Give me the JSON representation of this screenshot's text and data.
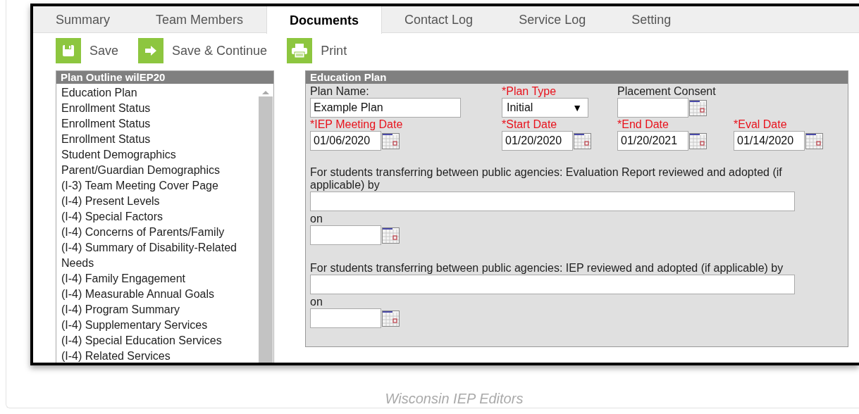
{
  "tabs": [
    {
      "label": "Summary",
      "selected": false
    },
    {
      "label": "Team Members",
      "selected": false
    },
    {
      "label": "Documents",
      "selected": true
    },
    {
      "label": "Contact Log",
      "selected": false
    },
    {
      "label": "Service Log",
      "selected": false
    },
    {
      "label": "Setting",
      "selected": false
    }
  ],
  "toolbar": [
    {
      "label": "Save",
      "kind": "save"
    },
    {
      "label": "Save & Continue",
      "kind": "continue"
    },
    {
      "label": "Print",
      "kind": "print"
    }
  ],
  "outline": {
    "title": "Plan Outline wilEP20",
    "items": [
      "Education Plan",
      "Enrollment Status",
      "Enrollment Status",
      "Enrollment Status",
      "Student Demographics",
      "Parent/Guardian Demographics",
      "(I-3) Team Meeting Cover Page",
      "(I-4) Present Levels",
      "(I-4) Special Factors",
      "(I-4) Concerns of Parents/Family",
      "(I-4) Summary of Disability-Related Needs",
      "(I-4) Family Engagement",
      "(I-4) Measurable Annual Goals",
      "(I-4) Program Summary",
      "(I-4) Supplementary Services",
      "(I-4) Special Education Services",
      "(I-4) Related Services"
    ]
  },
  "form": {
    "title": "Education Plan",
    "rows": [
      {
        "fields": [
          {
            "label": "Plan Name:",
            "required": false,
            "kind": "text",
            "value": "Example Plan"
          },
          {
            "label": "*Plan Type",
            "required": true,
            "kind": "select",
            "value": "Initial",
            "arrow": "▼"
          },
          {
            "label": "Placement Consent",
            "required": false,
            "kind": "date"
          }
        ]
      },
      {
        "fields": [
          {
            "label": "*IEP Meeting Date",
            "required": true,
            "kind": "date",
            "value": "01/06/2020"
          },
          {
            "label": "*Start Date",
            "required": true,
            "kind": "date",
            "value": "01/20/2020"
          },
          {
            "label": "*End Date",
            "required": true,
            "kind": "date",
            "value": "01/20/2021"
          },
          {
            "label": "*Eval Date",
            "required": true,
            "kind": "date",
            "value": "01/14/2020"
          }
        ]
      }
    ],
    "transfers": [
      {
        "label": "For students transferring between public agencies: Evaluation Report reviewed and adopted (if applicable) by",
        "on_label": "on"
      },
      {
        "label": "For students transferring between public agencies: IEP reviewed and adopted (if applicable) by",
        "on_label": "on"
      }
    ]
  },
  "caption": "Wisconsin IEP Editors"
}
